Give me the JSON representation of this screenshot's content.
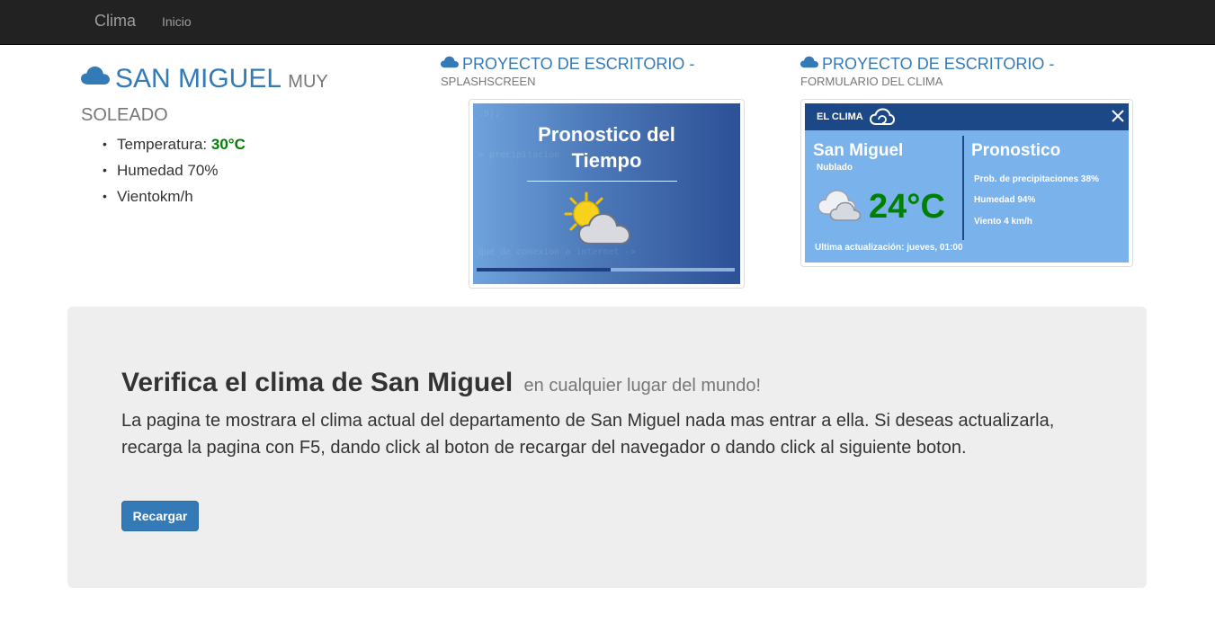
{
  "navbar": {
    "brand": "Clima",
    "links": [
      "Inicio"
    ]
  },
  "current": {
    "city": "SAN MIGUEL",
    "condition_line1": "MUY",
    "condition_line2": "SOLEADO",
    "temperature_label": "Temperatura: ",
    "temperature_value": "30°C",
    "humidity": "Humedad 70%",
    "wind": "Vientokm/h",
    "icon": "cloud-icon"
  },
  "projects": [
    {
      "title": "PROYECTO DE ESCRITORIO -",
      "subtitle": "SPLASHSCREEN",
      "icon": "cloud-icon",
      "screen": {
        "title_line1": "Pronostico del",
        "title_line2": "Tiempo",
        "ghost_text_1": ".9);",
        "ghost_text_2": "= precipitacion",
        "ghost_text_3": "que de conexion a internet ->",
        "progress": 0.52
      }
    },
    {
      "title": "PROYECTO DE ESCRITORIO -",
      "subtitle": "FORMULARIO DEL CLIMA",
      "icon": "cloud-icon",
      "screen": {
        "app_label": "EL CLIMA",
        "city": "San Miguel",
        "condition": "Nublado",
        "temperature": "24°C",
        "forecast_title": "Pronostico",
        "precip": "Prob. de precipitaciones 38%",
        "humidity": "Humedad 94%",
        "wind": "Viento 4 km/h",
        "updated": "Ultima actualización: jueves, 01:00"
      }
    }
  ],
  "jumbotron": {
    "title": "Verifica el clima de San Miguel",
    "subtitle": "en cualquier lugar del mundo!",
    "text": "La pagina te mostrara el clima actual del departamento de San Miguel nada mas entrar a ella. Si deseas actualizarla, recarga la pagina con F5, dando click al boton de recargar del navegador o dando click al siguiente boton.",
    "button": "Recargar"
  },
  "colors": {
    "navbar": "#222222",
    "link": "#337ab7",
    "temperature": "#008000",
    "button": "#337ab7",
    "jumbotron": "#eeeeee"
  }
}
